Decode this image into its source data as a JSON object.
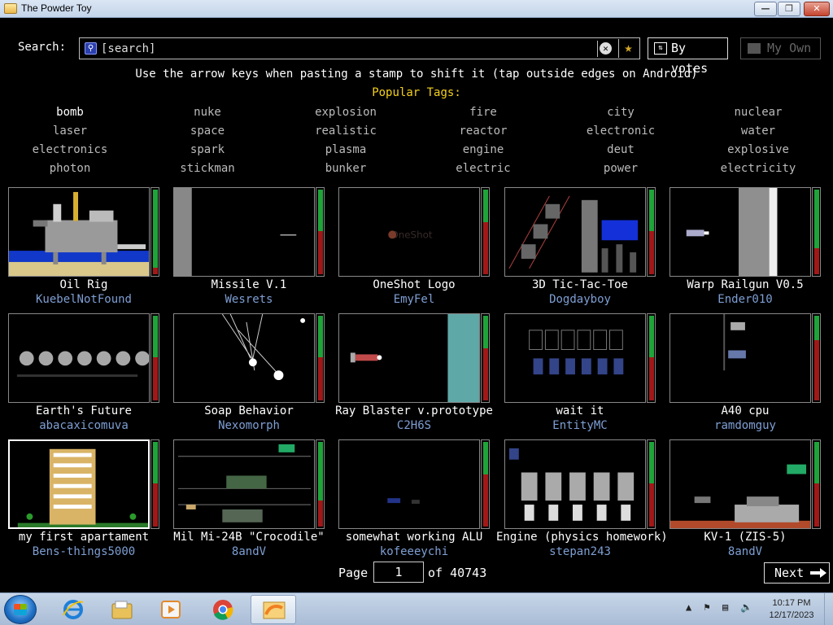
{
  "window": {
    "title": "The Powder Toy"
  },
  "search": {
    "label": "Search:",
    "value": "[search]",
    "sort_label": "By votes",
    "own_label": "My Own"
  },
  "hint": "Use the arrow keys when pasting a stamp to shift it (tap outside edges on Android)",
  "tags_title": "Popular Tags:",
  "tags": [
    [
      "bomb",
      "nuke",
      "explosion",
      "fire",
      "city",
      "nuclear"
    ],
    [
      "laser",
      "space",
      "realistic",
      "reactor",
      "electronic",
      "water"
    ],
    [
      "electronics",
      "spark",
      "plasma",
      "engine",
      "deut",
      "explosive"
    ],
    [
      "photon",
      "stickman",
      "bunker",
      "electric",
      "power",
      "electricity"
    ]
  ],
  "saves": [
    {
      "title": "Oil Rig",
      "author": "KuebelNotFound",
      "up": 0.92
    },
    {
      "title": "Missile V.1",
      "author": "Wesrets",
      "up": 0.5
    },
    {
      "title": "OneShot Logo",
      "author": "EmyFel",
      "up": 0.4
    },
    {
      "title": "3D Tic-Tac-Toe",
      "author": "Dogdayboy",
      "up": 0.5
    },
    {
      "title": "Warp Railgun V0.5",
      "author": "Ender010",
      "up": 0.7
    },
    {
      "title": "Earth's Future",
      "author": "abacaxicomuva",
      "up": 0.5
    },
    {
      "title": "Soap Behavior",
      "author": "Nexomorph",
      "up": 0.5
    },
    {
      "title": "Ray Blaster v.prototype",
      "author": "C2H6S",
      "up": 0.4
    },
    {
      "title": "wait it",
      "author": "EntityMC",
      "up": 0.5
    },
    {
      "title": "A40 cpu",
      "author": "ramdomguy",
      "up": 0.3
    },
    {
      "title": "my first apartament",
      "author": "Bens-things5000",
      "up": 0.5
    },
    {
      "title": "Mil Mi-24B \"Crocodile\"",
      "author": "8andV",
      "up": 0.7
    },
    {
      "title": "somewhat working ALU",
      "author": "kofeeeychi",
      "up": 0.4
    },
    {
      "title": "Engine (physics homework)",
      "author": "stepan243",
      "up": 0.5
    },
    {
      "title": "KV-1 (ZIS-5)",
      "author": "8andV",
      "up": 0.5
    }
  ],
  "pagination": {
    "page_label": "Page",
    "page": "1",
    "of_label": "of 40743",
    "next_label": "Next"
  },
  "taskbar": {
    "time": "10:17 PM",
    "date": "12/17/2023"
  }
}
